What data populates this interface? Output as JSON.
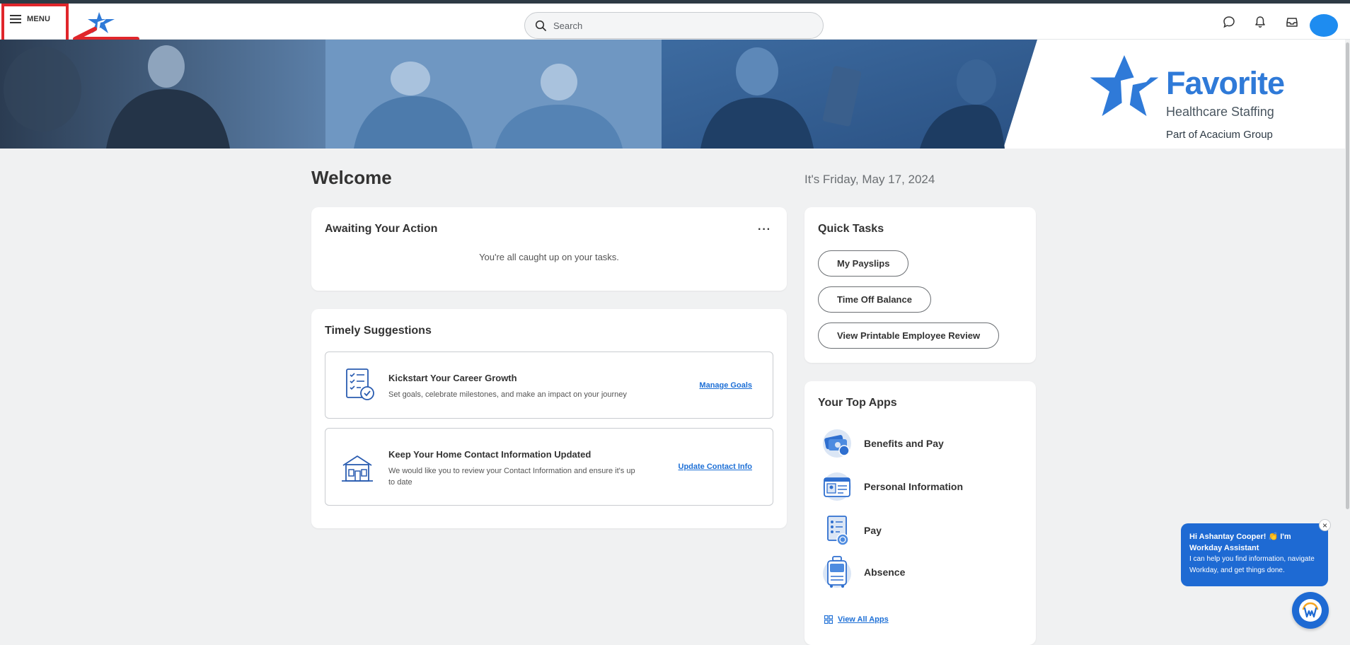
{
  "topbar": {
    "menu_label": "MENU",
    "search_placeholder": "Search",
    "icons": [
      "chat-icon",
      "bell-icon",
      "inbox-icon"
    ],
    "accent": "#1e8cf0"
  },
  "banner": {
    "brand_name": "Favorite",
    "brand_tagline": "Healthcare Staffing",
    "brand_group": "Part of Acacium Group",
    "brand_color": "#2f7ad8"
  },
  "welcome": {
    "heading": "Welcome",
    "date": "It's Friday, May 17, 2024"
  },
  "awaiting": {
    "title": "Awaiting Your Action",
    "more": "···",
    "empty_message": "You're all caught up on your tasks."
  },
  "timely": {
    "title": "Timely Suggestions",
    "items": [
      {
        "title": "Kickstart Your Career Growth",
        "description": "Set goals, celebrate milestones, and make an impact on your journey",
        "link": "Manage Goals",
        "icon": "checklist-icon"
      },
      {
        "title": "Keep Your Home Contact Information Updated",
        "description": "We would like you to review your Contact Information and ensure it's up to date",
        "link": "Update Contact Info",
        "icon": "house-icon"
      }
    ]
  },
  "quick_tasks": {
    "title": "Quick Tasks",
    "buttons": [
      "My Payslips",
      "Time Off Balance",
      "View Printable Employee Review"
    ]
  },
  "top_apps": {
    "title": "Your Top Apps",
    "apps": [
      {
        "label": "Benefits and Pay",
        "icon": "benefits-icon"
      },
      {
        "label": "Personal Information",
        "icon": "id-card-icon"
      },
      {
        "label": "Pay",
        "icon": "pay-icon"
      },
      {
        "label": "Absence",
        "icon": "luggage-icon"
      }
    ],
    "view_all": "View All Apps"
  },
  "assistant": {
    "greeting": "Hi Ashantay Cooper! 👏 I'm Workday Assistant",
    "body": "I can help you find information, navigate Workday, and get things done.",
    "close": "×"
  }
}
